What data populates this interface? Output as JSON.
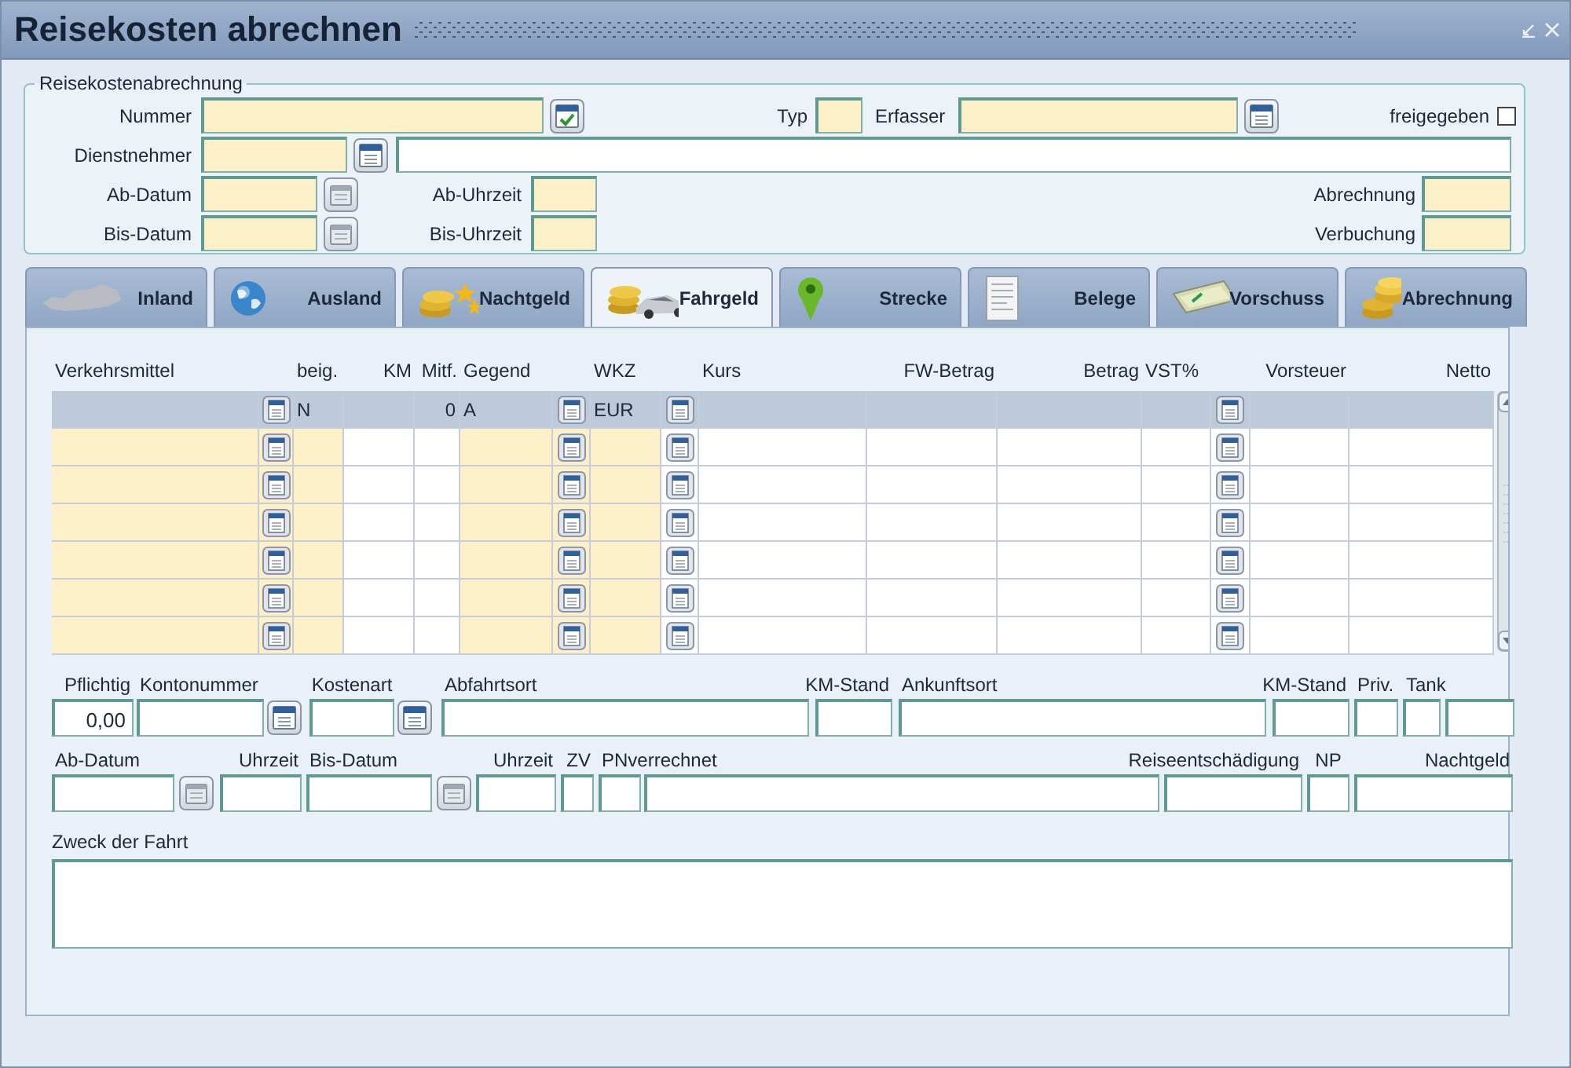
{
  "window": {
    "title": "Reisekosten abrechnen"
  },
  "header": {
    "legend": "Reisekostenabrechnung",
    "nummer_label": "Nummer",
    "typ_label": "Typ",
    "erfasser_label": "Erfasser",
    "freigegeben": {
      "label": "freigegeben",
      "checked": false
    },
    "dienstnehmer_label": "Dienstnehmer",
    "ab_datum_label": "Ab-Datum",
    "ab_uhrzeit_label": "Ab-Uhrzeit",
    "abrechnung_label": "Abrechnung",
    "bis_datum_label": "Bis-Datum",
    "bis_uhrzeit_label": "Bis-Uhrzeit",
    "verbuchung_label": "Verbuchung"
  },
  "tabs": [
    {
      "label": "Inland",
      "selected": false
    },
    {
      "label": "Ausland",
      "selected": false
    },
    {
      "label": "Nachtgeld",
      "selected": false
    },
    {
      "label": "Fahrgeld",
      "selected": true
    },
    {
      "label": "Strecke",
      "selected": false
    },
    {
      "label": "Belege",
      "selected": false
    },
    {
      "label": "Vorschuss",
      "selected": false
    },
    {
      "label": "Abrechnung",
      "selected": false
    }
  ],
  "table": {
    "columns": [
      "Verkehrsmittel",
      "beig.",
      "KM",
      "Mitf.",
      "Gegend",
      "WKZ",
      "Kurs",
      "FW-Betrag",
      "Betrag",
      "VST%",
      "Vorsteuer",
      "Netto"
    ],
    "rows": [
      {
        "selected": true,
        "beig": "N",
        "mitf": "0",
        "gegend": "A",
        "wkz": "EUR"
      },
      {
        "selected": false
      },
      {
        "selected": false
      },
      {
        "selected": false
      },
      {
        "selected": false
      },
      {
        "selected": false
      },
      {
        "selected": false
      }
    ]
  },
  "form": {
    "row1": [
      {
        "label": "Pflichtig",
        "value": "0,00"
      },
      {
        "label": "Kontonummer"
      },
      {
        "label": "Kostenart"
      },
      {
        "label": "Abfahrtsort"
      },
      {
        "label": "KM-Stand"
      },
      {
        "label": "Ankunftsort"
      },
      {
        "label": "KM-Stand"
      },
      {
        "label": "Priv."
      },
      {
        "label": "Tank"
      }
    ],
    "row2": [
      {
        "label": "Ab-Datum"
      },
      {
        "label": "Uhrzeit"
      },
      {
        "label": "Bis-Datum"
      },
      {
        "label": "Uhrzeit"
      },
      {
        "label": "ZV"
      },
      {
        "label": "PNverrechnet"
      },
      {
        "label": "Reiseentschädigung"
      },
      {
        "label": "NP"
      },
      {
        "label": "Nachtgeld"
      }
    ],
    "purpose": {
      "label": "Zweck der Fahrt"
    }
  }
}
